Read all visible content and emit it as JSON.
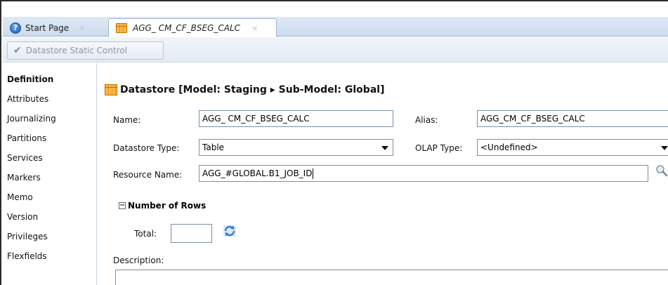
{
  "tabs": [
    {
      "label": "Start Page",
      "icon": "help-icon"
    },
    {
      "label": "AGG_ CM_CF_BSEG_CALC",
      "icon": "datastore-table-icon"
    }
  ],
  "tab_close_glyph": "×",
  "help_glyph": "?",
  "toolbar": {
    "static_control_label": "Datastore Static Control",
    "check_glyph": "✔"
  },
  "sidebar": {
    "items": [
      {
        "label": "Definition",
        "active": true
      },
      {
        "label": "Attributes"
      },
      {
        "label": "Journalizing"
      },
      {
        "label": "Partitions"
      },
      {
        "label": "Services"
      },
      {
        "label": "Markers"
      },
      {
        "label": "Memo"
      },
      {
        "label": "Version"
      },
      {
        "label": "Privileges"
      },
      {
        "label": "Flexfields"
      }
    ]
  },
  "main": {
    "section_title": "Datastore [Model: Staging ▸ Sub-Model: Global]",
    "name_label": "Name:",
    "name_value": "AGG_ CM_CF_BSEG_CALC",
    "alias_label": "Alias:",
    "alias_value": "AGG_CM_CF_BSEG_CALC",
    "datastore_type_label": "Datastore Type:",
    "datastore_type_value": "Table",
    "olap_type_label": "OLAP Type:",
    "olap_type_value": "<Undefined>",
    "resource_name_label": "Resource Name:",
    "resource_name_value": "AGG_#GLOBAL.B1_JOB_ID",
    "number_of_rows_title": "Number of Rows",
    "collapse_glyph": "−",
    "total_label": "Total:",
    "total_value": "",
    "description_label": "Description:",
    "description_value": ""
  },
  "colors": {
    "tab_strip": "#cddcee",
    "accent_icon": "#f7b84a",
    "border": "#7f8fa5"
  }
}
